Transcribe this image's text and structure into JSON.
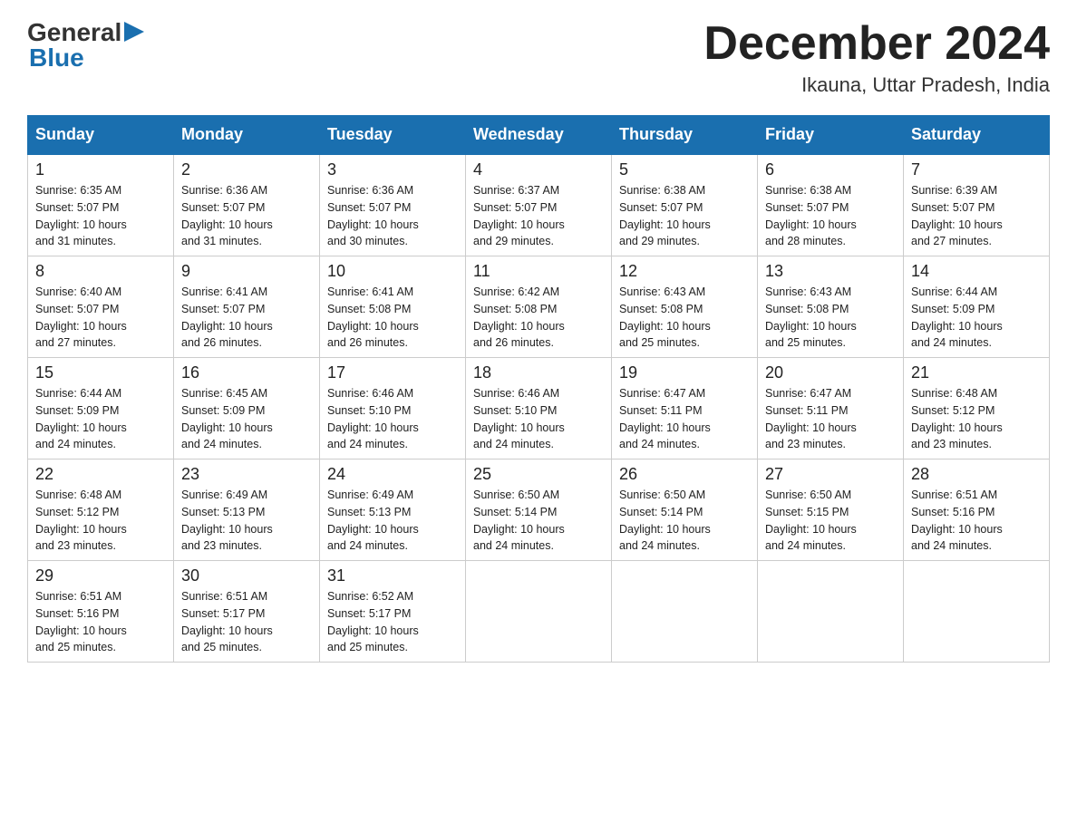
{
  "header": {
    "logo_general": "General",
    "logo_blue": "Blue",
    "month_title": "December 2024",
    "location": "Ikauna, Uttar Pradesh, India"
  },
  "days_of_week": [
    "Sunday",
    "Monday",
    "Tuesday",
    "Wednesday",
    "Thursday",
    "Friday",
    "Saturday"
  ],
  "weeks": [
    [
      {
        "day": "1",
        "sunrise": "6:35 AM",
        "sunset": "5:07 PM",
        "daylight": "10 hours and 31 minutes."
      },
      {
        "day": "2",
        "sunrise": "6:36 AM",
        "sunset": "5:07 PM",
        "daylight": "10 hours and 31 minutes."
      },
      {
        "day": "3",
        "sunrise": "6:36 AM",
        "sunset": "5:07 PM",
        "daylight": "10 hours and 30 minutes."
      },
      {
        "day": "4",
        "sunrise": "6:37 AM",
        "sunset": "5:07 PM",
        "daylight": "10 hours and 29 minutes."
      },
      {
        "day": "5",
        "sunrise": "6:38 AM",
        "sunset": "5:07 PM",
        "daylight": "10 hours and 29 minutes."
      },
      {
        "day": "6",
        "sunrise": "6:38 AM",
        "sunset": "5:07 PM",
        "daylight": "10 hours and 28 minutes."
      },
      {
        "day": "7",
        "sunrise": "6:39 AM",
        "sunset": "5:07 PM",
        "daylight": "10 hours and 27 minutes."
      }
    ],
    [
      {
        "day": "8",
        "sunrise": "6:40 AM",
        "sunset": "5:07 PM",
        "daylight": "10 hours and 27 minutes."
      },
      {
        "day": "9",
        "sunrise": "6:41 AM",
        "sunset": "5:07 PM",
        "daylight": "10 hours and 26 minutes."
      },
      {
        "day": "10",
        "sunrise": "6:41 AM",
        "sunset": "5:08 PM",
        "daylight": "10 hours and 26 minutes."
      },
      {
        "day": "11",
        "sunrise": "6:42 AM",
        "sunset": "5:08 PM",
        "daylight": "10 hours and 26 minutes."
      },
      {
        "day": "12",
        "sunrise": "6:43 AM",
        "sunset": "5:08 PM",
        "daylight": "10 hours and 25 minutes."
      },
      {
        "day": "13",
        "sunrise": "6:43 AM",
        "sunset": "5:08 PM",
        "daylight": "10 hours and 25 minutes."
      },
      {
        "day": "14",
        "sunrise": "6:44 AM",
        "sunset": "5:09 PM",
        "daylight": "10 hours and 24 minutes."
      }
    ],
    [
      {
        "day": "15",
        "sunrise": "6:44 AM",
        "sunset": "5:09 PM",
        "daylight": "10 hours and 24 minutes."
      },
      {
        "day": "16",
        "sunrise": "6:45 AM",
        "sunset": "5:09 PM",
        "daylight": "10 hours and 24 minutes."
      },
      {
        "day": "17",
        "sunrise": "6:46 AM",
        "sunset": "5:10 PM",
        "daylight": "10 hours and 24 minutes."
      },
      {
        "day": "18",
        "sunrise": "6:46 AM",
        "sunset": "5:10 PM",
        "daylight": "10 hours and 24 minutes."
      },
      {
        "day": "19",
        "sunrise": "6:47 AM",
        "sunset": "5:11 PM",
        "daylight": "10 hours and 24 minutes."
      },
      {
        "day": "20",
        "sunrise": "6:47 AM",
        "sunset": "5:11 PM",
        "daylight": "10 hours and 23 minutes."
      },
      {
        "day": "21",
        "sunrise": "6:48 AM",
        "sunset": "5:12 PM",
        "daylight": "10 hours and 23 minutes."
      }
    ],
    [
      {
        "day": "22",
        "sunrise": "6:48 AM",
        "sunset": "5:12 PM",
        "daylight": "10 hours and 23 minutes."
      },
      {
        "day": "23",
        "sunrise": "6:49 AM",
        "sunset": "5:13 PM",
        "daylight": "10 hours and 23 minutes."
      },
      {
        "day": "24",
        "sunrise": "6:49 AM",
        "sunset": "5:13 PM",
        "daylight": "10 hours and 24 minutes."
      },
      {
        "day": "25",
        "sunrise": "6:50 AM",
        "sunset": "5:14 PM",
        "daylight": "10 hours and 24 minutes."
      },
      {
        "day": "26",
        "sunrise": "6:50 AM",
        "sunset": "5:14 PM",
        "daylight": "10 hours and 24 minutes."
      },
      {
        "day": "27",
        "sunrise": "6:50 AM",
        "sunset": "5:15 PM",
        "daylight": "10 hours and 24 minutes."
      },
      {
        "day": "28",
        "sunrise": "6:51 AM",
        "sunset": "5:16 PM",
        "daylight": "10 hours and 24 minutes."
      }
    ],
    [
      {
        "day": "29",
        "sunrise": "6:51 AM",
        "sunset": "5:16 PM",
        "daylight": "10 hours and 25 minutes."
      },
      {
        "day": "30",
        "sunrise": "6:51 AM",
        "sunset": "5:17 PM",
        "daylight": "10 hours and 25 minutes."
      },
      {
        "day": "31",
        "sunrise": "6:52 AM",
        "sunset": "5:17 PM",
        "daylight": "10 hours and 25 minutes."
      },
      null,
      null,
      null,
      null
    ]
  ],
  "labels": {
    "sunrise": "Sunrise:",
    "sunset": "Sunset:",
    "daylight": "Daylight:"
  }
}
